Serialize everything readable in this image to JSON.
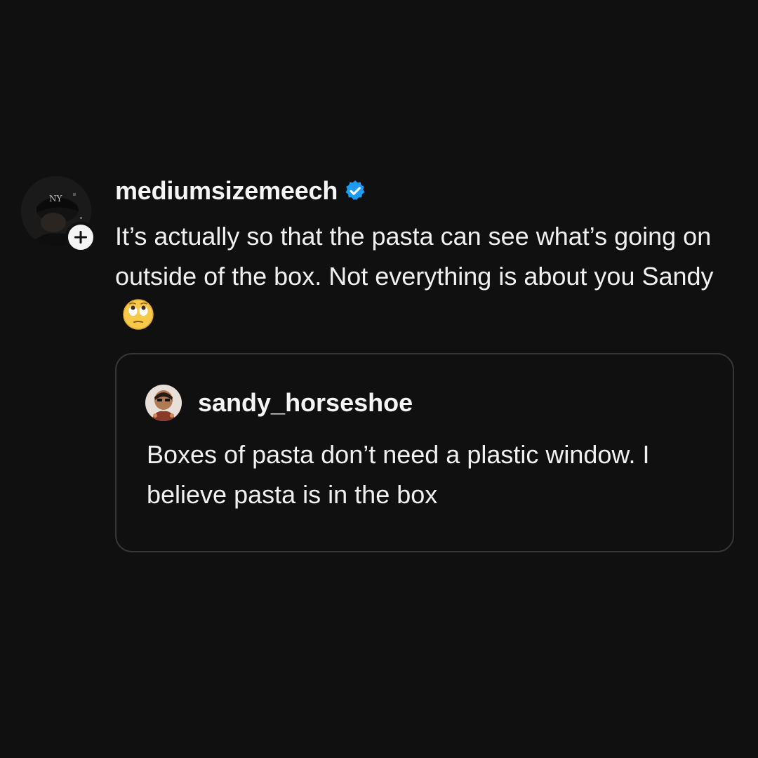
{
  "post": {
    "username": "mediumsizemeech",
    "verified": true,
    "text": "It’s actually so that the pasta can see what’s going on outside of the box. Not everything is about you Sandy",
    "emoji": "face-with-rolling-eyes",
    "avatar": "profile-photo-dark-cap"
  },
  "quoted_post": {
    "username": "sandy_horseshoe",
    "text": "Boxes of pasta don’t need a plastic window. I believe pasta is in the box",
    "avatar": "profile-photo-figure"
  },
  "colors": {
    "background": "#101010",
    "text": "#f3f3f3",
    "verified_badge": "#1d9bf0",
    "card_border": "#363636"
  }
}
